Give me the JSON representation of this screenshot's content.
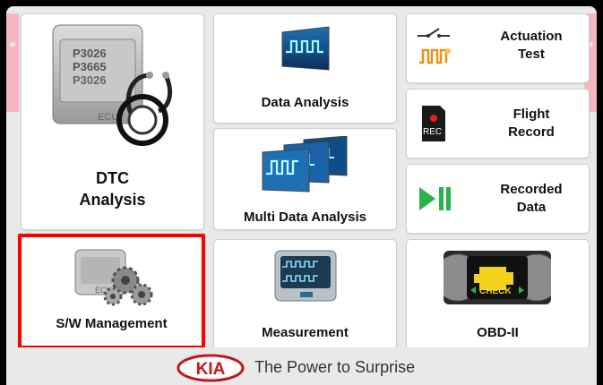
{
  "tiles": {
    "dtc": {
      "label_line1": "DTC",
      "label_line2": "Analysis",
      "icon_codes": [
        "P3026",
        "P3665",
        "P3026"
      ],
      "ecu_text": "ECU"
    },
    "data_analysis": {
      "label": "Data Analysis"
    },
    "actuation": {
      "label_line1": "Actuation",
      "label_line2": "Test"
    },
    "flight_record": {
      "label_line1": "Flight",
      "label_line2": "Record",
      "rec_text": "REC"
    },
    "multi_data": {
      "label": "Multi Data Analysis"
    },
    "recorded_data": {
      "label_line1": "Recorded",
      "label_line2": "Data"
    },
    "sw_management": {
      "label": "S/W Management",
      "ecu_text": "ECU"
    },
    "measurement": {
      "label": "Measurement"
    },
    "obd": {
      "label": "OBD-II",
      "check_text": "CHECK"
    }
  },
  "footer": {
    "brand": "KIA",
    "slogan": "The Power to Surprise"
  },
  "side": {
    "left_chevron": "»",
    "right_chevron": "«"
  },
  "colors": {
    "highlight": "#ff0000",
    "side_tab": "#f4b7c2",
    "kia_red": "#c4161c",
    "play_green": "#2bb24c",
    "rec_red": "#e02020"
  }
}
